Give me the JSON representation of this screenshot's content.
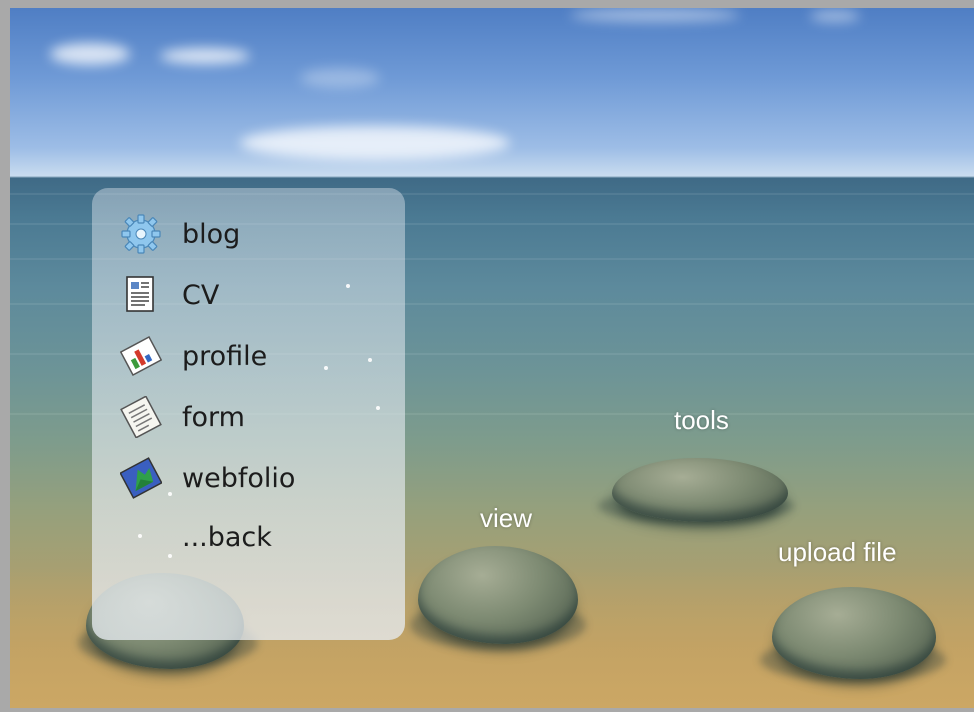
{
  "menu": {
    "items": [
      {
        "label": "blog",
        "icon": "gear-icon"
      },
      {
        "label": "CV",
        "icon": "document-icon"
      },
      {
        "label": "profile",
        "icon": "chart-card-icon"
      },
      {
        "label": "form",
        "icon": "form-icon"
      },
      {
        "label": "webfolio",
        "icon": "webfolio-icon"
      },
      {
        "label": "...back",
        "icon": ""
      }
    ]
  },
  "stones": {
    "tools": "tools",
    "view": "view",
    "upload": "upload file"
  }
}
